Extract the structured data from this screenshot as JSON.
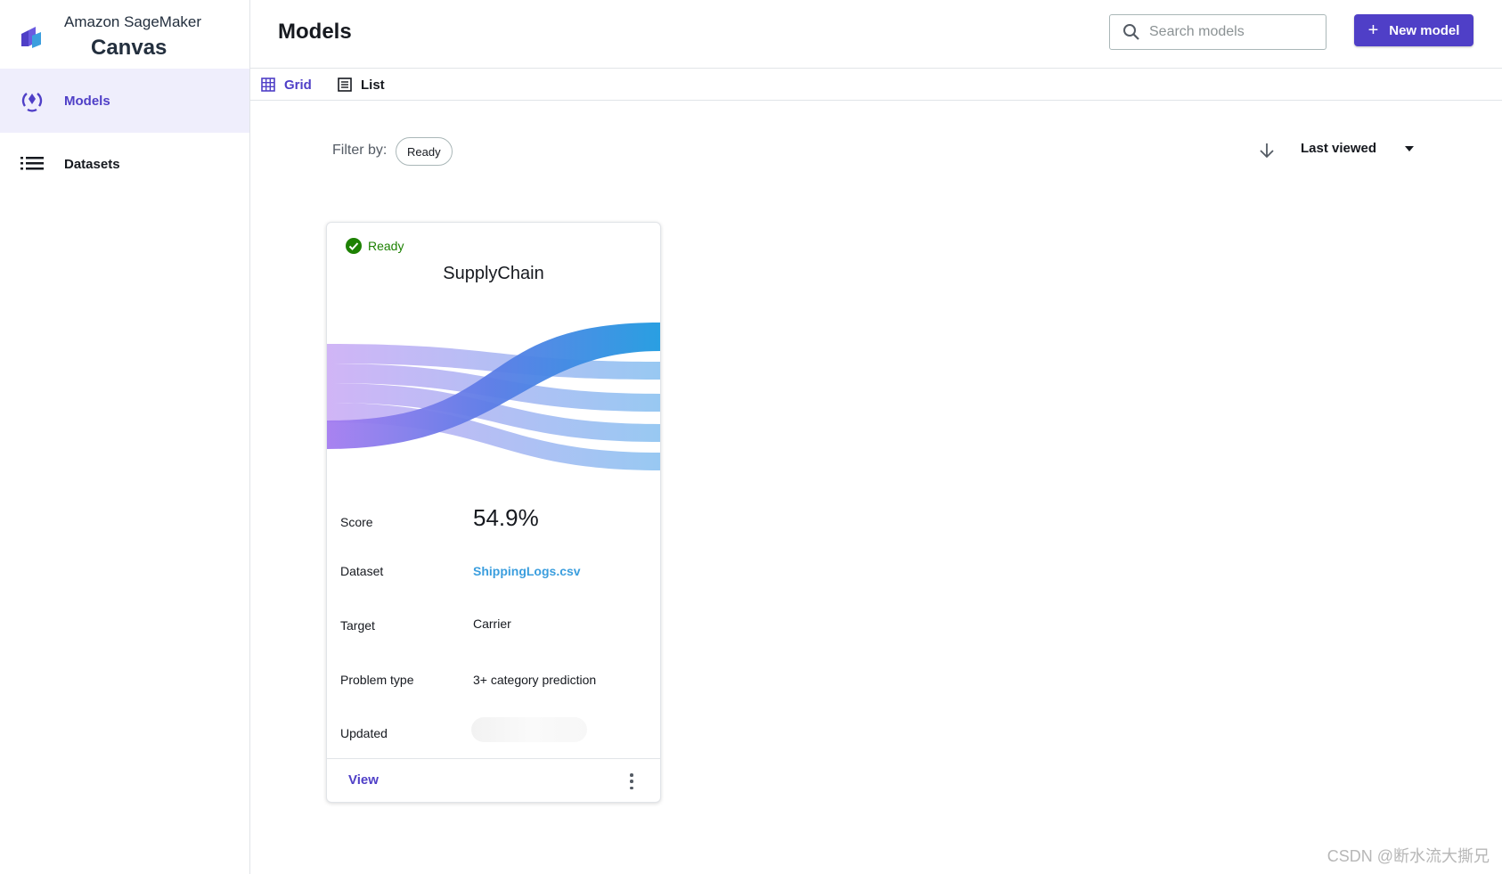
{
  "brand": {
    "line1": "Amazon SageMaker",
    "line2": "Canvas"
  },
  "sidebar": {
    "items": [
      {
        "label": "Models",
        "icon": "models-icon",
        "active": true
      },
      {
        "label": "Datasets",
        "icon": "list-icon",
        "active": false
      }
    ]
  },
  "header": {
    "title": "Models",
    "search_placeholder": "Search models",
    "search_value": "",
    "new_button": "New model"
  },
  "view": {
    "grid_label": "Grid",
    "list_label": "List",
    "selected": "Grid"
  },
  "filter": {
    "label": "Filter by:",
    "chip": "Ready"
  },
  "sort": {
    "label": "Last viewed",
    "direction": "descending"
  },
  "card": {
    "status": "Ready",
    "title": "SupplyChain",
    "fields": {
      "score_label": "Score",
      "score": "54.9%",
      "dataset_label": "Dataset",
      "dataset": "ShippingLogs.csv",
      "target_label": "Target",
      "target": "Carrier",
      "problem_label": "Problem type",
      "problem": "3+ category prediction",
      "updated_label": "Updated"
    },
    "view_label": "View"
  },
  "watermark": "CSDN @断水流大撕兄",
  "colors": {
    "accent": "#4f3fc7",
    "status_ok": "#1d8102",
    "link": "#3b9ede"
  }
}
